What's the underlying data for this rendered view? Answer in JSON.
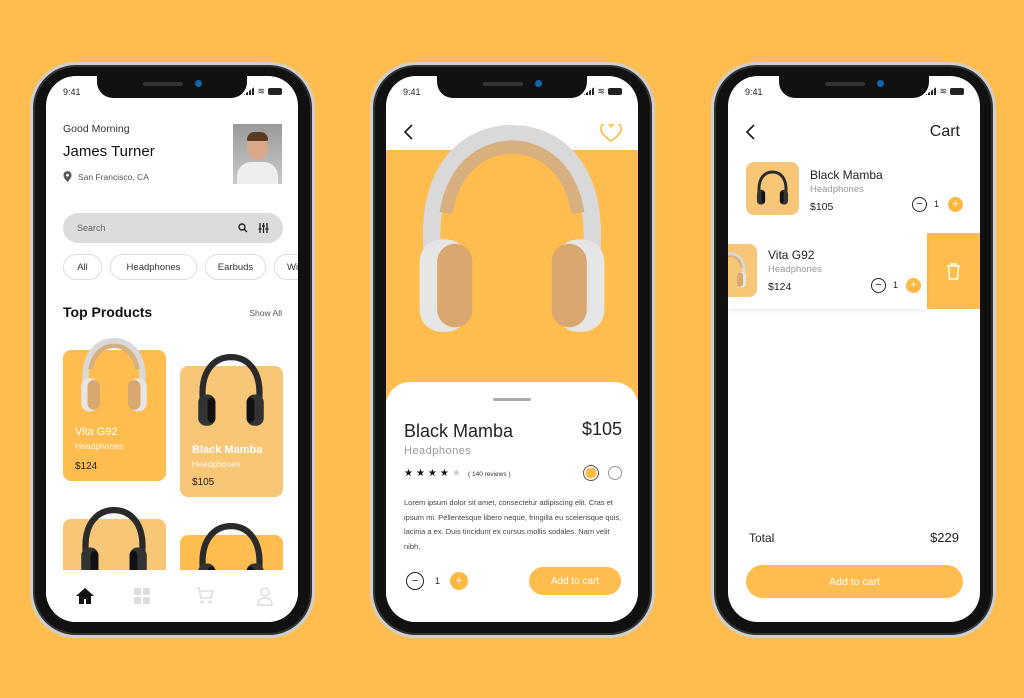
{
  "status_time": "9:41",
  "colors": {
    "background": "#FFBD4F",
    "accent": "#FFB940",
    "card_light": "#F7C676"
  },
  "home": {
    "greeting": "Good Morning",
    "user_name": "James Turner",
    "location": "San Francisco, CA",
    "search_placeholder": "Search",
    "chips": [
      "All",
      "Headphones",
      "Earbuds",
      "Wi"
    ],
    "section_title": "Top Products",
    "show_all": "Show All",
    "products": [
      {
        "name": "Vita G92",
        "category": "Headphones",
        "price": "$124"
      },
      {
        "name": "Black Mamba",
        "category": "Headphones",
        "price": "$105"
      }
    ],
    "nav": [
      "home-icon",
      "grid-icon",
      "cart-icon",
      "user-icon"
    ]
  },
  "detail": {
    "name": "Black Mamba",
    "category": "Headphones",
    "price": "$105",
    "rating": 4,
    "reviews": "( 140 reviews )",
    "description": "Lorem ipsum dolor sit amet, consectetur adipiscing elit. Cras et ipsum mi. Pellentesque libero neque, fringilla eu scelerisque quis, lacinia a ex. Duis tincidunt ex cursus mollis sodales. Nam velit nibh,",
    "quantity": "1",
    "add_to_cart": "Add to cart"
  },
  "cart": {
    "title": "Cart",
    "items": [
      {
        "name": "Black Mamba",
        "category": "Headphones",
        "price": "$105",
        "quantity": "1"
      },
      {
        "name": "Vita G92",
        "category": "Headphones",
        "price": "$124",
        "quantity": "1"
      }
    ],
    "total_label": "Total",
    "total_value": "$229",
    "add_to_cart": "Add to cart"
  }
}
